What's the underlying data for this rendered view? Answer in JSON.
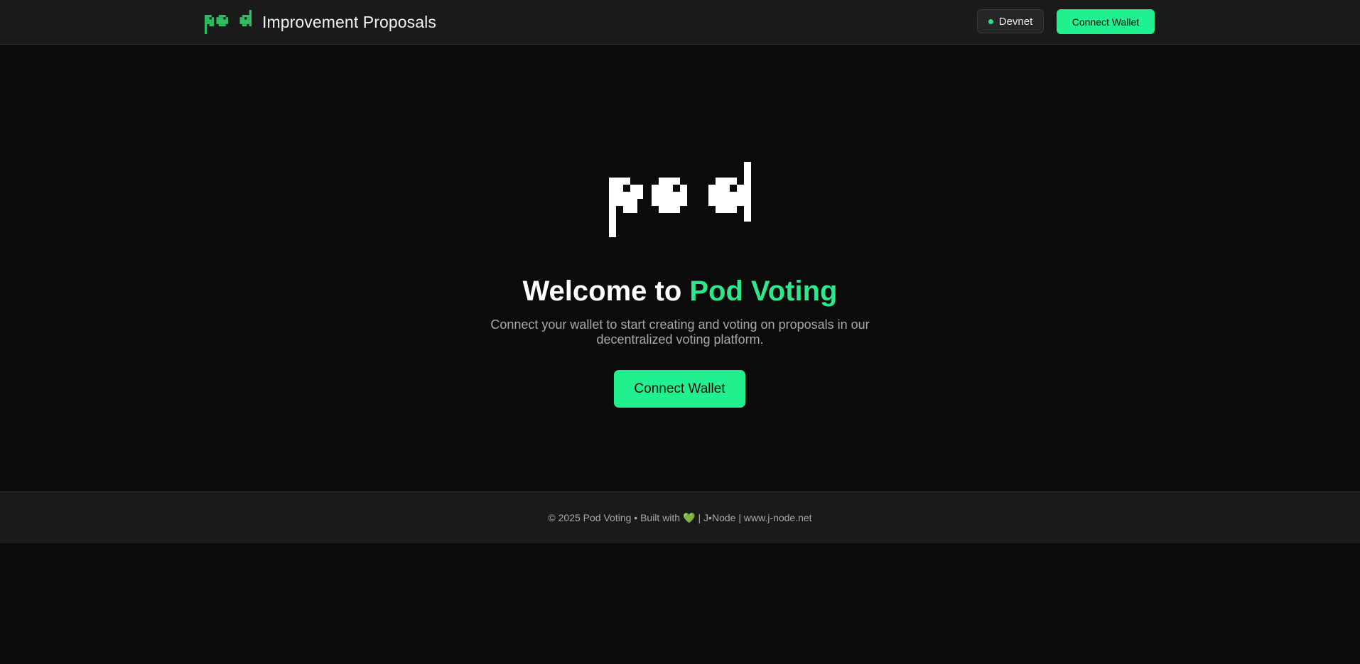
{
  "header": {
    "title": "Improvement Proposals",
    "network_label": "Devnet",
    "connect_label": "Connect Wallet"
  },
  "hero": {
    "title_prefix": "Welcome to ",
    "title_accent": "Pod Voting",
    "description": "Connect your wallet to start creating and voting on proposals in our decentralized voting platform.",
    "connect_label": "Connect Wallet",
    "logo_text": "pod"
  },
  "footer": {
    "copyright": "© 2025 Pod Voting • Built with",
    "heart": "💚",
    "credit": "| J•Node | www.j-node.net"
  },
  "icons": {
    "brand_logo": "pod-logo-icon",
    "network_status": "status-dot-icon",
    "heart": "green-heart-icon"
  },
  "colors": {
    "accent": "#21f08f",
    "accent_text": "#2ee68c",
    "brand_logo": "#2fbf62",
    "background": "#0b0b0b",
    "surface": "#1a1a1a"
  }
}
